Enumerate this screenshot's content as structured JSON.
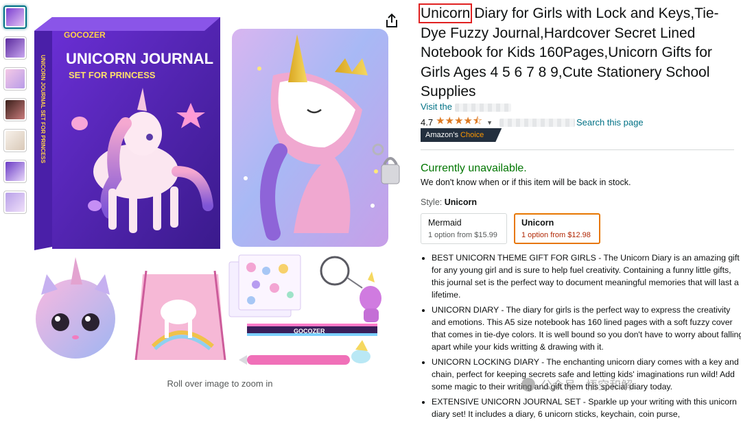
{
  "thumbnails": [
    {
      "id": "thumb-1",
      "colors": [
        "#7a3fd0",
        "#e6c4f5"
      ]
    },
    {
      "id": "thumb-2",
      "colors": [
        "#5b2a9e",
        "#c9a7f0"
      ]
    },
    {
      "id": "thumb-3",
      "colors": [
        "#f4c9e6",
        "#b99ce8"
      ]
    },
    {
      "id": "thumb-4",
      "colors": [
        "#3a1f1a",
        "#c97c7c"
      ]
    },
    {
      "id": "thumb-5",
      "colors": [
        "#f7f1ea",
        "#d9c9b8"
      ]
    },
    {
      "id": "thumb-6",
      "colors": [
        "#6a3bc4",
        "#e9d8fb"
      ]
    },
    {
      "id": "thumb-7",
      "colors": [
        "#b8a0e8",
        "#f0e0fa"
      ]
    }
  ],
  "main_image": {
    "box_brand": "GOCOZER",
    "box_title": "UNICORN JOURNAL",
    "box_subtitle": "SET FOR PRINCESS",
    "box_spine": "UNICORN JOURNAL SET FOR PRINCESS",
    "bracelet_text": "GOCOZER"
  },
  "zoom_hint": "Roll over image to zoom in",
  "title": {
    "highlighted": "Unicorn",
    "rest": " Diary for Girls with Lock and Keys,Tie-Dye Fuzzy Journal,Hardcover Secret Lined Notebook for Kids 160Pages,Unicorn Gifts for Girls Ages 4 5 6 7 8 9,Cute Stationery School Supplies"
  },
  "visit_link": "Visit the",
  "rating": {
    "value": "4.7",
    "stars": "★★★★⯪",
    "search_link": "Search this page"
  },
  "badge": {
    "prefix": "Amazon's ",
    "choice": "Choice"
  },
  "availability": {
    "status": "Currently unavailable.",
    "detail": "We don't know when or if this item will be back in stock."
  },
  "style": {
    "label": "Style: ",
    "selected": "Unicorn",
    "options": [
      {
        "name": "Mermaid",
        "price": "1 option from $15.99"
      },
      {
        "name": "Unicorn",
        "price": "1 option from $12.98"
      }
    ]
  },
  "bullets": [
    "BEST UNICORN THEME GIFT FOR GIRLS - The Unicorn Diary is an amazing gift for any young girl and is sure to help fuel creativity. Containing a funny little gifts, this journal set is the perfect way to document meaningful memories that will last a lifetime.",
    "UNICORN DIARY - The diary for girls is the perfect way to express the creativity and emotions. This A5 size notebook has 160 lined pages with a soft fuzzy cover that comes in tie-dye colors. It is well bound so you don't have to worry about falling apart while your kids writting & drawing with it.",
    "UNICORN LOCKING DIARY - The enchanting unicorn diary comes with a key and chain, perfect for keeping secrets safe and letting kids' imaginations run wild! Add some magic to their writing and gift them this special diary today.",
    "EXTENSIVE UNICORN JOURNAL SET - Sparkle up your writing with this unicorn diary set! It includes a diary, 6 unicorn sticks, keychain, coin purse,"
  ],
  "watermark": "公众号 · 悟空和解",
  "colors": {
    "link": "#007185",
    "available_green": "#007600",
    "price_red": "#b12704",
    "selected_border": "#e77600",
    "star": "#de7921"
  }
}
